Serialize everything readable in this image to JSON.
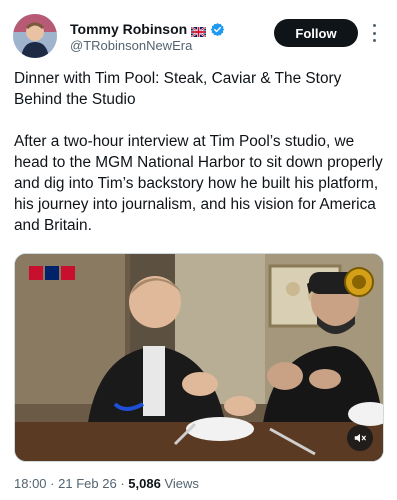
{
  "author": {
    "display_name": "Tommy Robinson",
    "handle": "@TRobinsonNewEra",
    "flag_icon": "uk-flag-icon",
    "verified_icon": "verified-badge-icon",
    "verified_color": "#1d9bf0"
  },
  "actions": {
    "follow_label": "Follow",
    "more_icon": "more-options-icon"
  },
  "tweet": {
    "title": "Dinner with Tim Pool: Steak, Caviar & The Story Behind the Studio",
    "body": "After a two-hour interview at Tim Pool’s studio, we head to the MGM National Harbor to sit down properly and dig into Tim’s backstory how he built his platform, his journey into journalism, and his vision for America and Britain."
  },
  "media": {
    "type": "video",
    "mute_icon": "volume-muted-icon"
  },
  "meta": {
    "time": "18:00",
    "separator": "·",
    "date": "21 Feb 26",
    "views": "5,086",
    "views_label": "Views"
  },
  "colors": {
    "text": "#0f1419",
    "secondary": "#536471",
    "button_bg": "#0f1419"
  }
}
